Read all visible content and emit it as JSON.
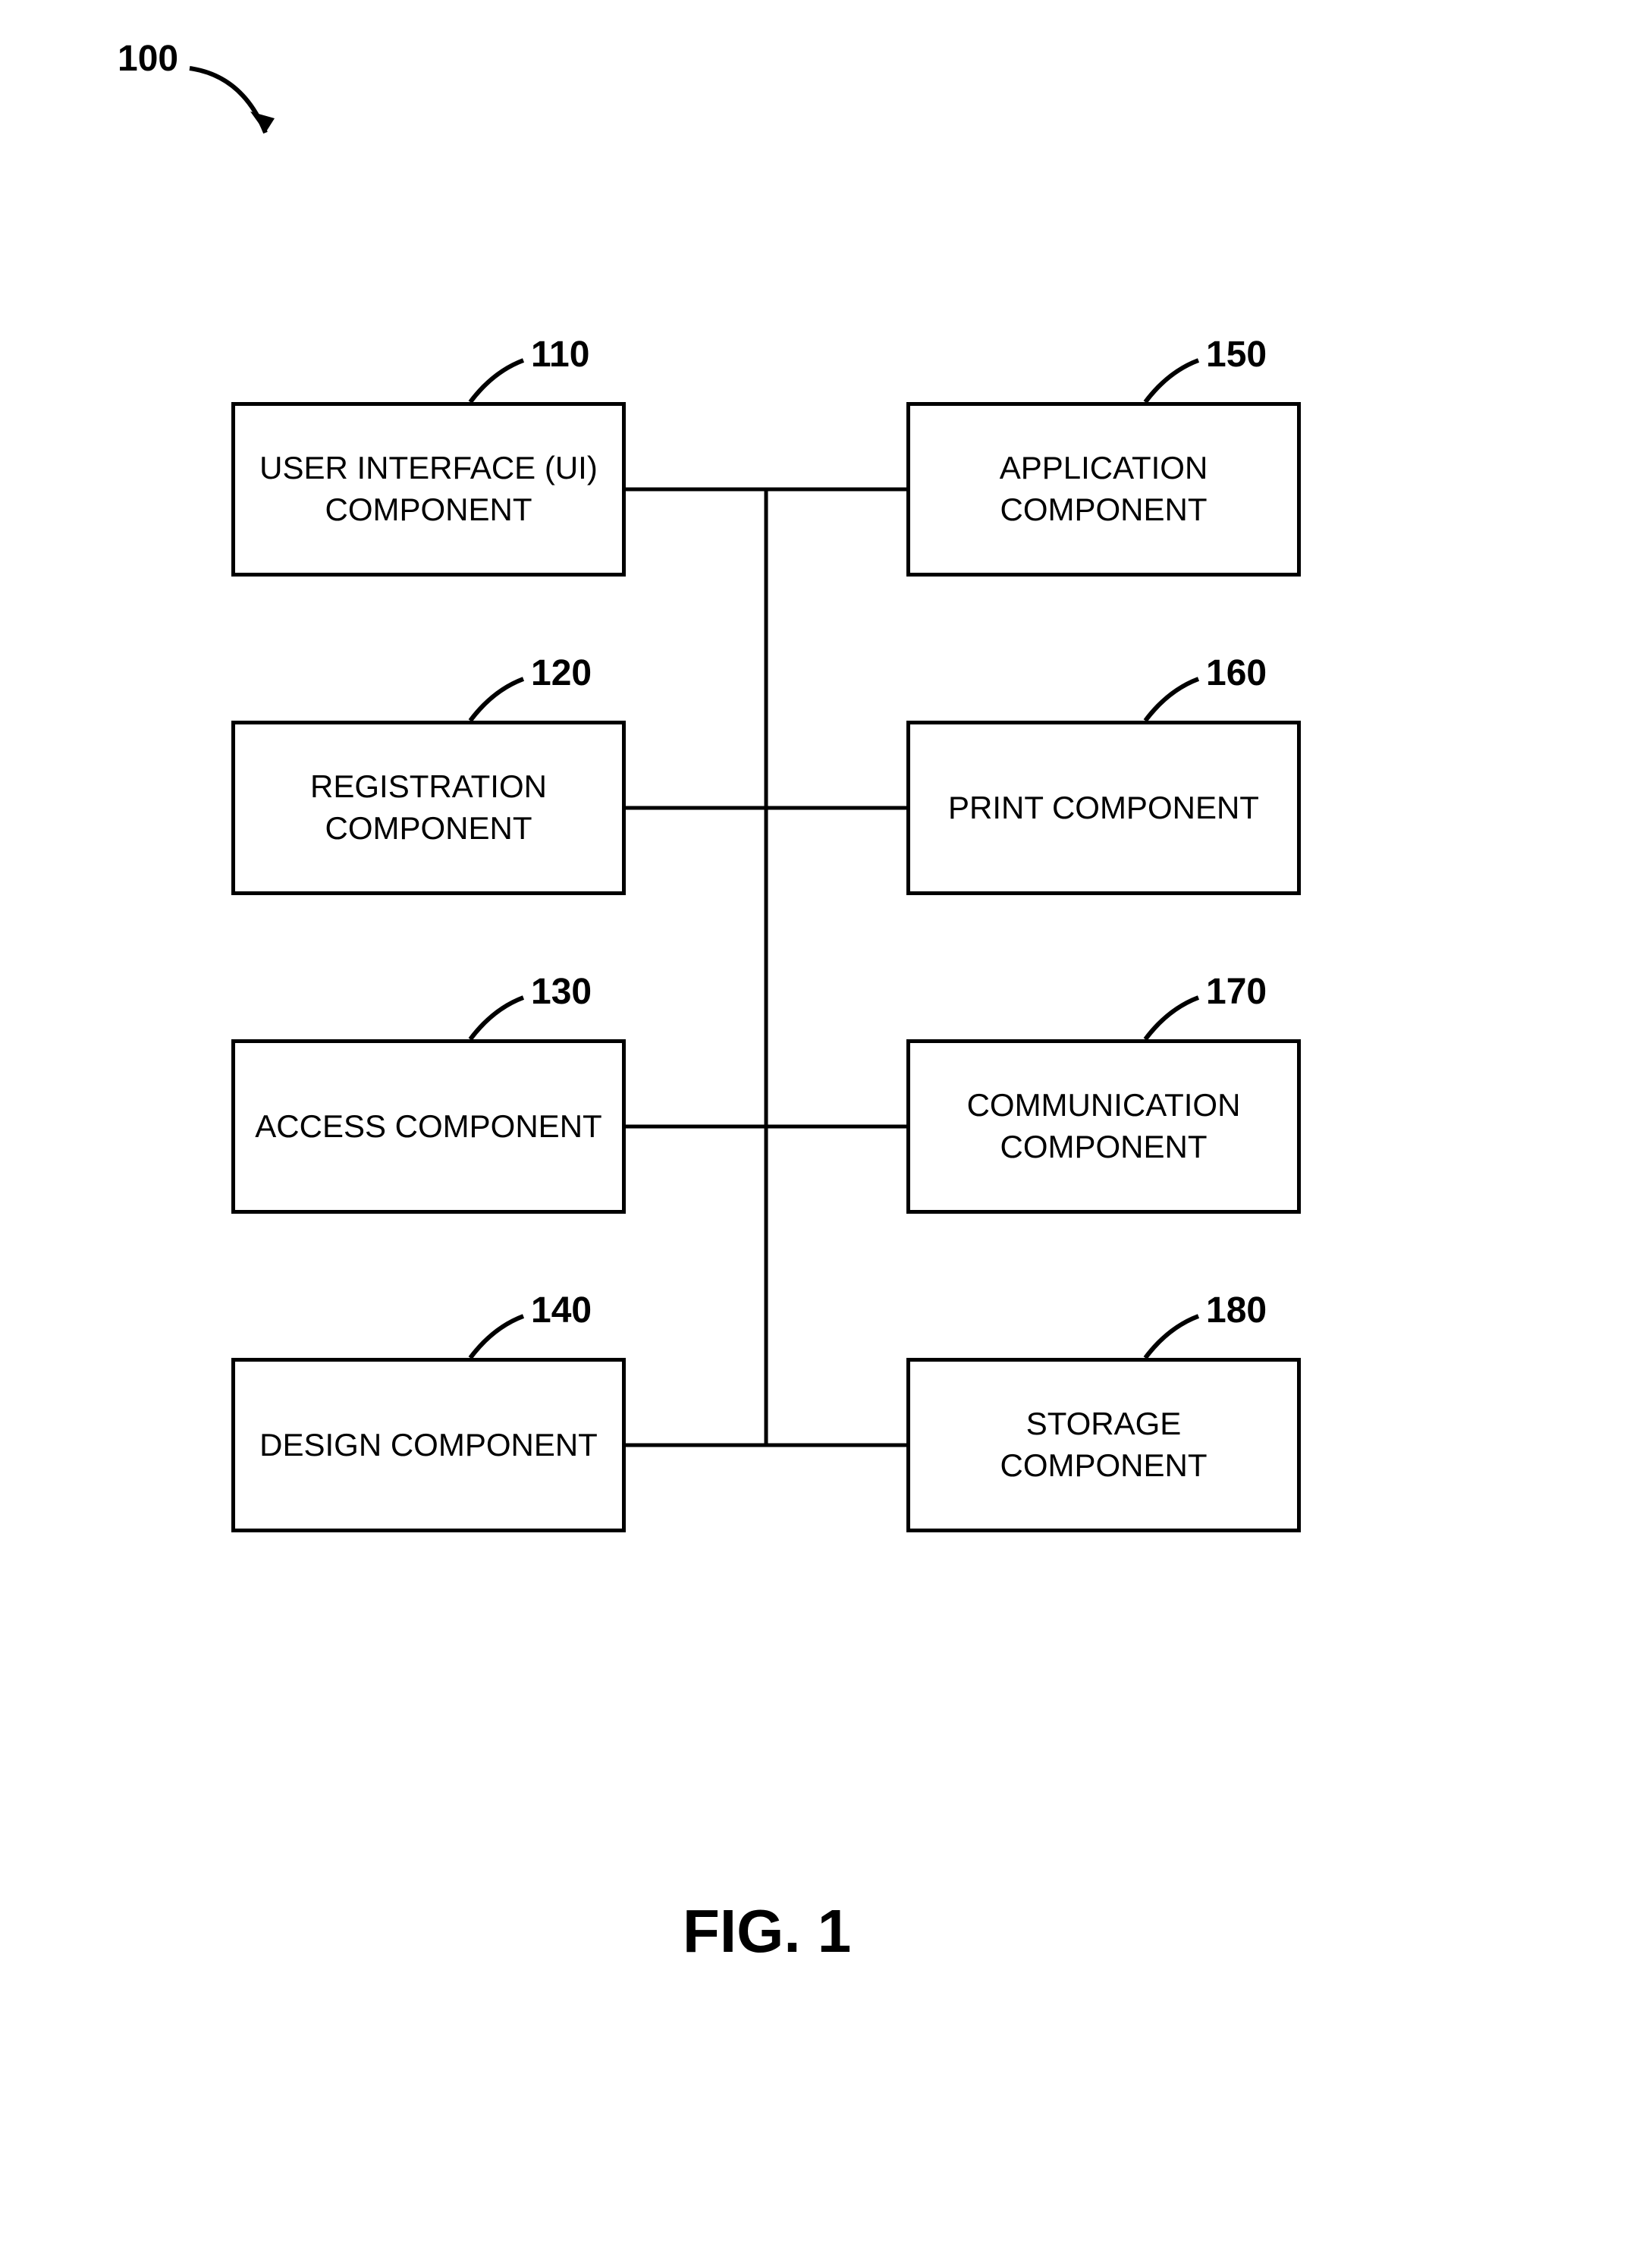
{
  "figure": {
    "ref": "100",
    "caption": "FIG. 1"
  },
  "boxes": {
    "b110": {
      "ref": "110",
      "label": "USER INTERFACE (UI)\nCOMPONENT"
    },
    "b120": {
      "ref": "120",
      "label": "REGISTRATION\nCOMPONENT"
    },
    "b130": {
      "ref": "130",
      "label": "ACCESS COMPONENT"
    },
    "b140": {
      "ref": "140",
      "label": "DESIGN COMPONENT"
    },
    "b150": {
      "ref": "150",
      "label": "APPLICATION\nCOMPONENT"
    },
    "b160": {
      "ref": "160",
      "label": "PRINT COMPONENT"
    },
    "b170": {
      "ref": "170",
      "label": "COMMUNICATION\nCOMPONENT"
    },
    "b180": {
      "ref": "180",
      "label": "STORAGE\nCOMPONENT"
    }
  }
}
